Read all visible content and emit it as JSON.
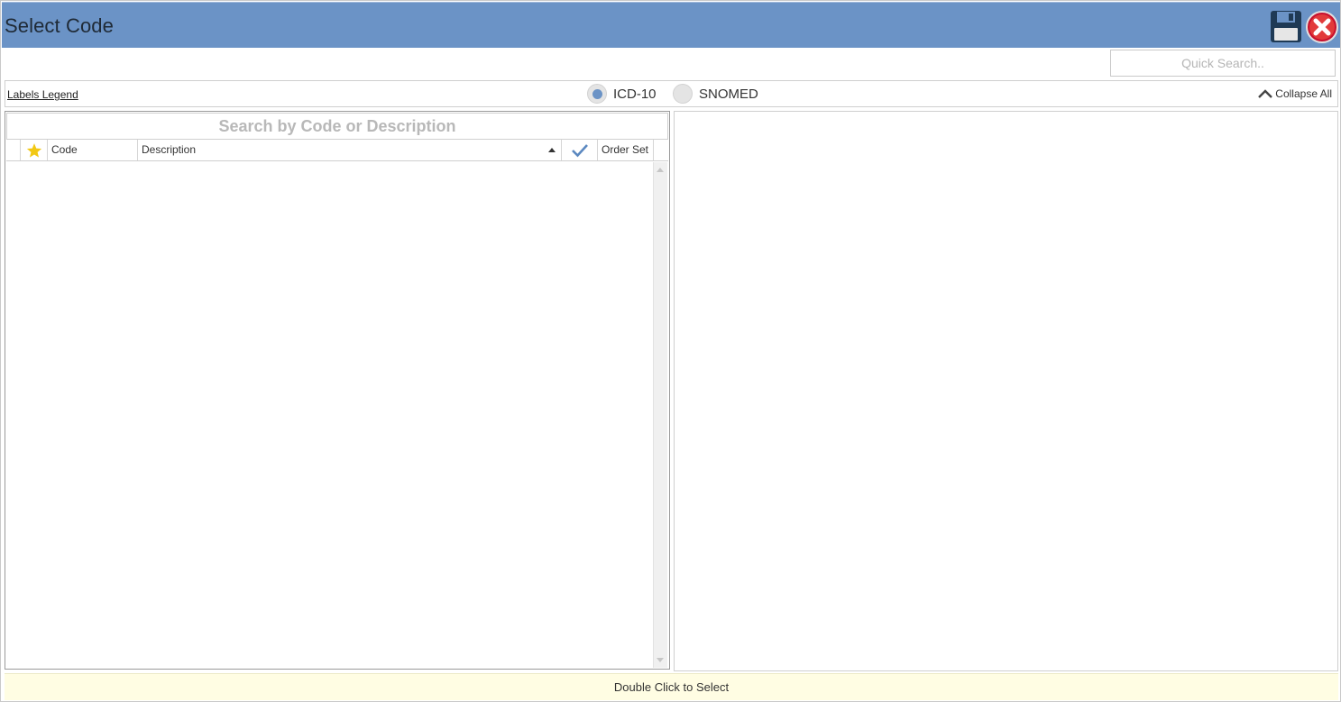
{
  "window": {
    "title": "Select Code"
  },
  "toolbar": {
    "save_icon": "floppy-disk-icon",
    "close_icon": "close-circle-icon",
    "quick_search_placeholder": "Quick Search..",
    "labels_legend": "Labels Legend",
    "code_systems": [
      {
        "label": "ICD-10",
        "selected": true
      },
      {
        "label": "SNOMED",
        "selected": false
      }
    ],
    "collapse_all": "Collapse All"
  },
  "search_grid": {
    "search_placeholder": "Search by Code or Description",
    "columns": {
      "favorite_icon": "star-icon",
      "code": "Code",
      "description": "Description",
      "selected_icon": "checkmark-icon",
      "order_set": "Order Set"
    },
    "rows": []
  },
  "status": {
    "hint": "Double Click to Select"
  },
  "colors": {
    "titlebar": "#6b93c6",
    "accent": "#6b93c6",
    "star": "#f2c814",
    "status_bg": "#fffde3"
  }
}
